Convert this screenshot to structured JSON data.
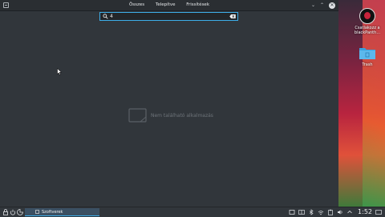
{
  "window": {
    "tabs": [
      "Összes",
      "Telepítve",
      "Frissítések"
    ],
    "controls": [
      "chevron-down-icon",
      "maximize-icon",
      "close-icon"
    ]
  },
  "search": {
    "value": "4"
  },
  "empty_state": {
    "message": "Nem található alkalmazás"
  },
  "desktop": {
    "icons": [
      {
        "label": "Csatlakozz a blackPanth..."
      },
      {
        "label": "Trash"
      }
    ]
  },
  "taskbar": {
    "task_label": "Szoftverek",
    "clock": "1:52"
  },
  "colors": {
    "accent": "#3daee9",
    "window_bg": "#31363b",
    "panel_bg": "#2a2e32"
  }
}
